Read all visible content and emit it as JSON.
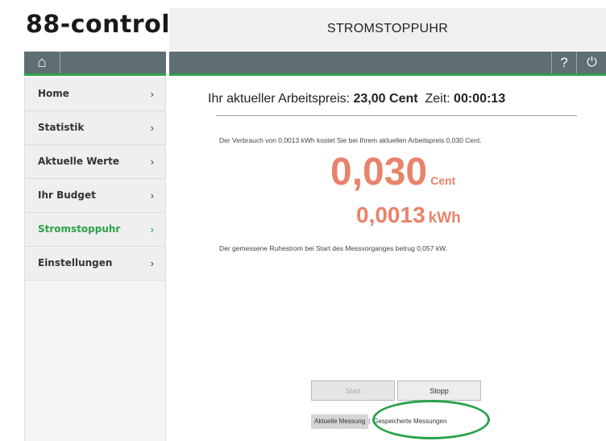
{
  "header": {
    "logo_text": "88-control",
    "title": "STROMSTOPPUHR"
  },
  "toolbar": {
    "home_icon": "home-icon",
    "help_label": "?",
    "power_icon": "power-icon"
  },
  "sidebar": {
    "items": [
      {
        "label": "Home",
        "active": false
      },
      {
        "label": "Statistik",
        "active": false
      },
      {
        "label": "Aktuelle Werte",
        "active": false
      },
      {
        "label": "Ihr Budget",
        "active": false
      },
      {
        "label": "Stromstoppuhr",
        "active": true
      },
      {
        "label": "Einstellungen",
        "active": false
      }
    ],
    "chevron": "›"
  },
  "main": {
    "price_prefix": "Ihr aktueller Arbeitspreis:",
    "price_value": "23,00 Cent",
    "time_label": "Zeit:",
    "time_value": "00:00:13",
    "consumption_text": "Der Verbrauch von 0,0013 kWh kostet Sie bei Ihrem aktuellen Arbeitspreis 0,030 Cent.",
    "cost_value": "0,030",
    "cost_unit": "Cent",
    "kwh_value": "0,0013",
    "kwh_unit": "kWh",
    "standby_text": "Der gemessene Ruhestrom bei Start des Messvorganges betrug 0,057 kW.",
    "start_label": "Start",
    "stop_label": "Stopp",
    "tab_current": "Aktuelle Messung",
    "tab_saved": "Gespeicherte Messungen"
  },
  "colors": {
    "accent_green": "#2aa14a",
    "bar_gray": "#5e6e73",
    "value_orange": "#e8836b"
  }
}
